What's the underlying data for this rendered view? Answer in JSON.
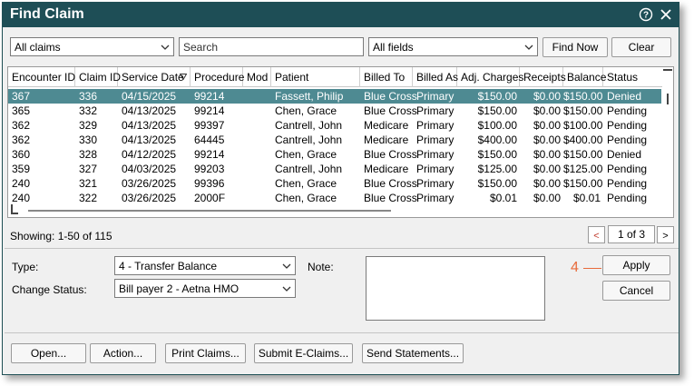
{
  "window": {
    "title": "Find Claim"
  },
  "filters": {
    "claims_filter": "All claims",
    "search_placeholder": "Search",
    "fields_filter": "All fields",
    "find_now_label": "Find Now",
    "clear_label": "Clear"
  },
  "table": {
    "columns": [
      "Encounter ID",
      "Claim ID",
      "Service Date",
      "Procedure",
      "Mod",
      "Patient",
      "Billed To",
      "Billed As",
      "Adj. Charges",
      "Receipts",
      "Balance",
      "Status"
    ],
    "rows": [
      [
        "367",
        "336",
        "04/15/2025",
        "99214",
        "",
        "Fassett, Philip",
        "Blue Cross",
        "Primary",
        "$150.00",
        "$0.00",
        "$150.00",
        "Denied"
      ],
      [
        "365",
        "332",
        "04/13/2025",
        "99214",
        "",
        "Chen, Grace",
        "Blue Cross",
        "Primary",
        "$150.00",
        "$0.00",
        "$150.00",
        "Pending"
      ],
      [
        "362",
        "329",
        "04/13/2025",
        "99397",
        "",
        "Cantrell, John",
        "Medicare",
        "Primary",
        "$100.00",
        "$0.00",
        "$100.00",
        "Pending"
      ],
      [
        "362",
        "330",
        "04/13/2025",
        "64445",
        "",
        "Cantrell, John",
        "Medicare",
        "Primary",
        "$400.00",
        "$0.00",
        "$400.00",
        "Pending"
      ],
      [
        "360",
        "328",
        "04/12/2025",
        "99214",
        "",
        "Chen, Grace",
        "Blue Cross",
        "Primary",
        "$150.00",
        "$0.00",
        "$150.00",
        "Denied"
      ],
      [
        "359",
        "327",
        "04/03/2025",
        "99203",
        "",
        "Cantrell, John",
        "Medicare",
        "Primary",
        "$125.00",
        "$0.00",
        "$125.00",
        "Pending"
      ],
      [
        "240",
        "321",
        "03/26/2025",
        "99396",
        "",
        "Chen, Grace",
        "Blue Cross",
        "Primary",
        "$150.00",
        "$0.00",
        "$150.00",
        "Pending"
      ],
      [
        "240",
        "322",
        "03/26/2025",
        "2000F",
        "",
        "Chen, Grace",
        "Blue Cross",
        "Primary",
        "$0.01",
        "$0.00",
        "$0.01",
        "Pending"
      ]
    ]
  },
  "pagination": {
    "showing": "Showing: 1-50 of 115",
    "page": "1 of 3",
    "prev_glyph": "<",
    "next_glyph": ">"
  },
  "form": {
    "type_label": "Type:",
    "type_value": "4 - Transfer Balance",
    "status_label": "Change Status:",
    "status_value": "Bill payer 2 - Aetna HMO",
    "note_label": "Note:",
    "apply_label": "Apply",
    "cancel_label": "Cancel",
    "callout_number": "4"
  },
  "footer": {
    "buttons": [
      "Open...",
      "Action...",
      "Print Claims...",
      "Submit E-Claims...",
      "Send Statements..."
    ]
  },
  "colors": {
    "titlebar": "#1e4e56",
    "selected_row": "#4e8a92",
    "callout": "#e86a3a"
  }
}
